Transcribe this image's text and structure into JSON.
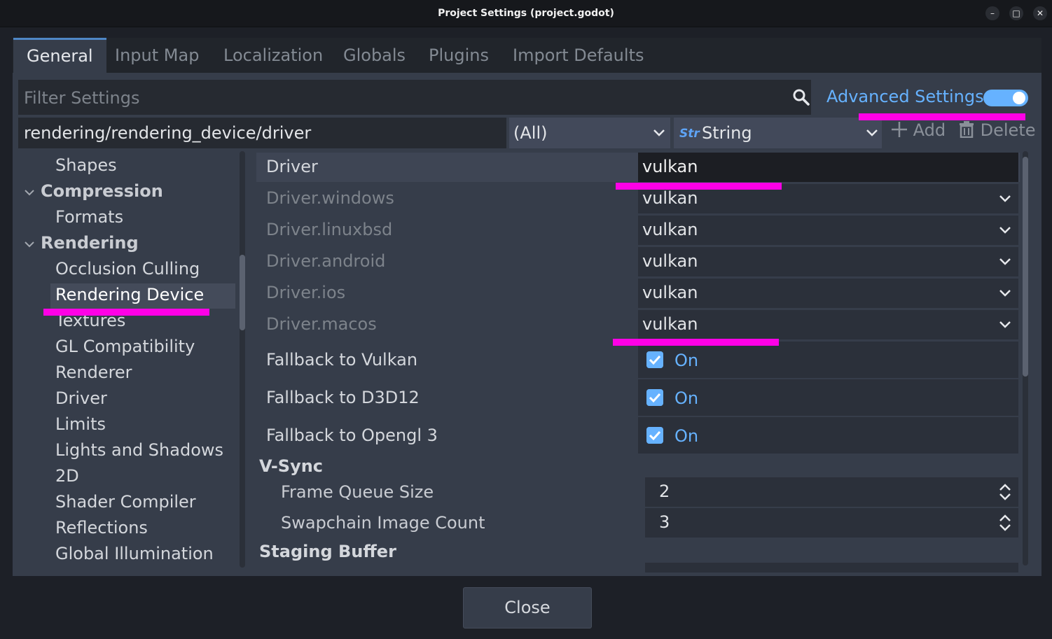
{
  "window": {
    "title": "Project Settings (project.godot)",
    "controls": {
      "minimize": "–",
      "maximize": "□",
      "close": "✕"
    }
  },
  "tabs": [
    "General",
    "Input Map",
    "Localization",
    "Globals",
    "Plugins",
    "Import Defaults"
  ],
  "active_tab": "General",
  "filter": {
    "placeholder": "Filter Settings"
  },
  "advanced_settings": {
    "label": "Advanced Settings",
    "enabled": true
  },
  "property_path": {
    "value": "rendering/rendering_device/driver"
  },
  "type_filter": {
    "value": "(All)"
  },
  "type_select": {
    "icon_text": "Str",
    "value": "String"
  },
  "add_label": "Add",
  "delete_label": "Delete",
  "tree": {
    "items": [
      {
        "label": "Shapes"
      },
      {
        "label": "Compression"
      },
      {
        "label": "Formats"
      },
      {
        "label": "Rendering"
      },
      {
        "label": "Occlusion Culling"
      },
      {
        "label": "Rendering Device"
      },
      {
        "label": "Textures"
      },
      {
        "label": "GL Compatibility"
      },
      {
        "label": "Renderer"
      },
      {
        "label": "Driver"
      },
      {
        "label": "Limits"
      },
      {
        "label": "Lights and Shadows"
      },
      {
        "label": "2D"
      },
      {
        "label": "Shader Compiler"
      },
      {
        "label": "Reflections"
      },
      {
        "label": "Global Illumination"
      }
    ]
  },
  "properties": {
    "driver": {
      "label": "Driver",
      "value": "vulkan"
    },
    "driver_windows": {
      "label": "Driver.windows",
      "value": "vulkan"
    },
    "driver_linuxbsd": {
      "label": "Driver.linuxbsd",
      "value": "vulkan"
    },
    "driver_android": {
      "label": "Driver.android",
      "value": "vulkan"
    },
    "driver_ios": {
      "label": "Driver.ios",
      "value": "vulkan"
    },
    "driver_macos": {
      "label": "Driver.macos",
      "value": "vulkan"
    },
    "fallback_vulkan": {
      "label": "Fallback to Vulkan",
      "value": "On",
      "checked": true
    },
    "fallback_d3d12": {
      "label": "Fallback to D3D12",
      "value": "On",
      "checked": true
    },
    "fallback_opengl3": {
      "label": "Fallback to Opengl 3",
      "value": "On",
      "checked": true
    }
  },
  "vsync": {
    "header": "V-Sync",
    "frame_queue_size": {
      "label": "Frame Queue Size",
      "value": "2"
    },
    "swapchain_image_count": {
      "label": "Swapchain Image Count",
      "value": "3"
    }
  },
  "staging_buffer": {
    "header": "Staging Buffer"
  },
  "close_label": "Close",
  "colors": {
    "accent": "#66b2ff",
    "highlight_marker": "#ff00e6"
  }
}
